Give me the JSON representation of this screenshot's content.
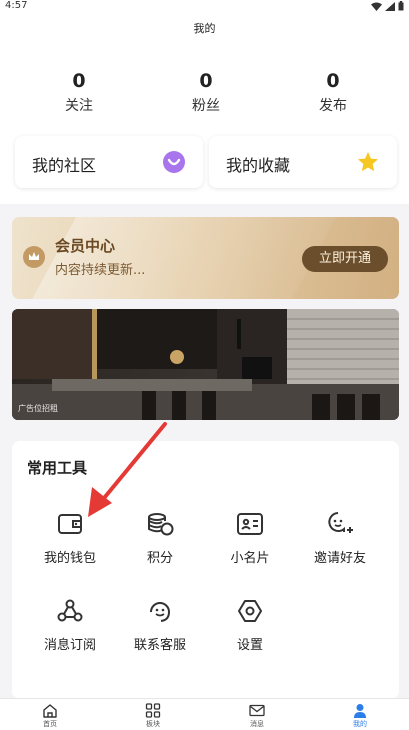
{
  "status_bar": {
    "time": "4:57"
  },
  "header": {
    "title": "我的"
  },
  "stats": [
    {
      "count": "0",
      "label": "关注"
    },
    {
      "count": "0",
      "label": "粉丝"
    },
    {
      "count": "0",
      "label": "发布"
    }
  ],
  "cards": {
    "community": "我的社区",
    "favorites": "我的收藏"
  },
  "vip": {
    "title": "会员中心",
    "subtitle": "内容持续更新...",
    "button": "立即开通"
  },
  "ad": {
    "tag": "广告位招租"
  },
  "tools": {
    "title": "常用工具",
    "items": [
      {
        "label": "我的钱包",
        "icon": "wallet-icon"
      },
      {
        "label": "积分",
        "icon": "coins-icon"
      },
      {
        "label": "小名片",
        "icon": "card-icon"
      },
      {
        "label": "邀请好友",
        "icon": "invite-friend-icon"
      },
      {
        "label": "消息订阅",
        "icon": "subscribe-icon"
      },
      {
        "label": "联系客服",
        "icon": "customer-service-icon"
      },
      {
        "label": "设置",
        "icon": "settings-icon"
      }
    ]
  },
  "tabbar": {
    "items": [
      {
        "label": "首页",
        "icon": "home-icon"
      },
      {
        "label": "板块",
        "icon": "grid-icon"
      },
      {
        "label": "消息",
        "icon": "mail-icon"
      },
      {
        "label": "我的",
        "icon": "person-icon"
      }
    ],
    "active_color": "#2b7de9"
  },
  "colors": {
    "accent": "#2b7de9",
    "vip_button": "#6b4e2b",
    "arrow": "#e53935"
  }
}
